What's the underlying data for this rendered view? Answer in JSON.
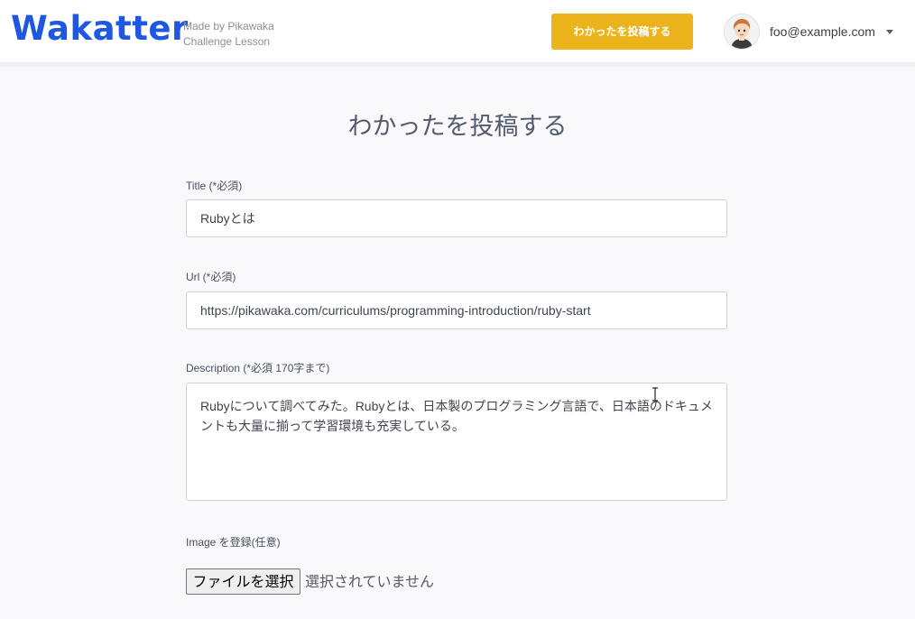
{
  "header": {
    "logo": "Wakatter",
    "tagline_line1": "Made by Pikawaka",
    "tagline_line2": "Challenge Lesson",
    "post_button": "わかったを投稿する",
    "user_email": "foo@example.com"
  },
  "form": {
    "title": "わかったを投稿する",
    "title_field": {
      "label": "Title (*必須)",
      "value": "Rubyとは"
    },
    "url_field": {
      "label": "Url (*必須)",
      "value": "https://pikawaka.com/curriculums/programming-introduction/ruby-start"
    },
    "description_field": {
      "label": "Description (*必須 170字まで)",
      "value": "Rubyについて調べてみた。Rubyとは、日本製のプログラミング言語で、日本語のドキュメントも大量に揃って学習環境も充実している。"
    },
    "image_field": {
      "label": "Image を登録(任意)",
      "button": "ファイルを選択",
      "status": "選択されていません"
    }
  },
  "colors": {
    "brand": "#1e57e0",
    "accent": "#ebb41b"
  },
  "icons": {
    "avatar": "user-avatar-icon",
    "caret": "caret-down-icon",
    "cursor": "text-cursor-icon"
  }
}
